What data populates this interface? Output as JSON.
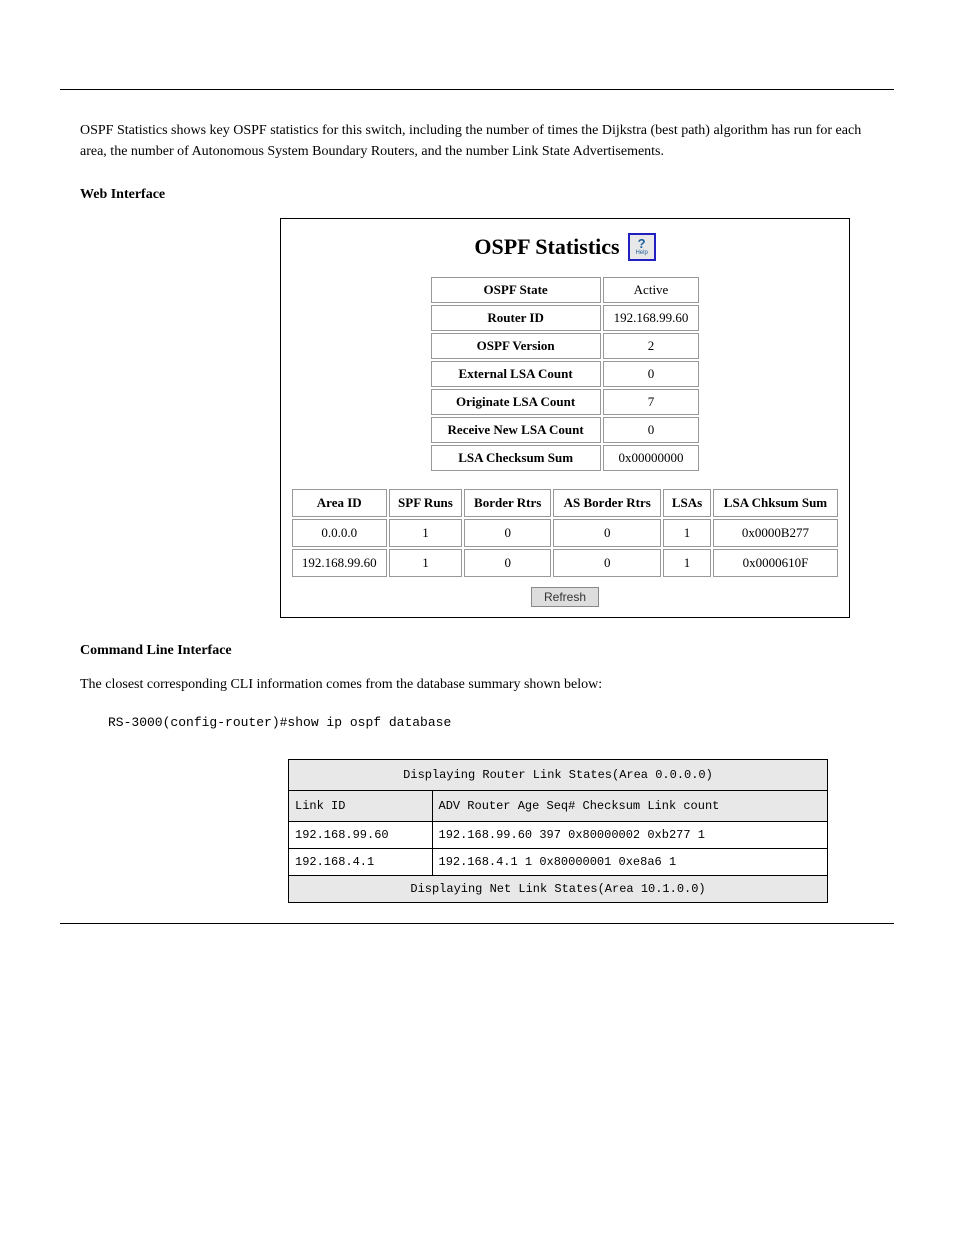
{
  "intro": "OSPF Statistics shows key OSPF statistics for this switch, including the number of times the Dijkstra (best path) algorithm has run for each area, the number of Autonomous System Boundary Routers, and the number Link State Advertisements.",
  "section_title": "Web Interface",
  "figure": {
    "title": "OSPF Statistics",
    "help_icon_label": "Help",
    "summary": [
      {
        "label": "OSPF State",
        "value": "Active"
      },
      {
        "label": "Router ID",
        "value": "192.168.99.60"
      },
      {
        "label": "OSPF Version",
        "value": "2"
      },
      {
        "label": "External LSA Count",
        "value": "0"
      },
      {
        "label": "Originate LSA Count",
        "value": "7"
      },
      {
        "label": "Receive New LSA Count",
        "value": "0"
      },
      {
        "label": "LSA Checksum Sum",
        "value": "0x00000000"
      }
    ],
    "area_headers": [
      "Area ID",
      "SPF Runs",
      "Border Rtrs",
      "AS Border Rtrs",
      "LSAs",
      "LSA Chksum Sum"
    ],
    "area_rows": [
      [
        "0.0.0.0",
        "1",
        "0",
        "0",
        "1",
        "0x0000B277"
      ],
      [
        "192.168.99.60",
        "1",
        "0",
        "0",
        "1",
        "0x0000610F"
      ]
    ],
    "refresh_label": "Refresh"
  },
  "cli_title": "Command Line Interface",
  "cli_lead": "The closest corresponding CLI information comes from the database summary shown below:",
  "cli_prompt": "RS-3000(config-router)#show ip ospf database",
  "cli_blank": "",
  "cli_table_header": "Displaying Router Link States(Area 0.0.0.0)",
  "cli_cols": [
    "Link ID",
    "ADV Router    Age    Seq#    Checksum    Link count"
  ],
  "cli_rows": [
    [
      "192.168.99.60",
      "192.168.99.60 397    0x80000002    0xb277    1"
    ],
    [
      "192.168.4.1",
      "192.168.4.1 1 0x80000001 0xe8a6 1"
    ]
  ],
  "cli_span_row": "Displaying Net Link States(Area 10.1.0.0)"
}
